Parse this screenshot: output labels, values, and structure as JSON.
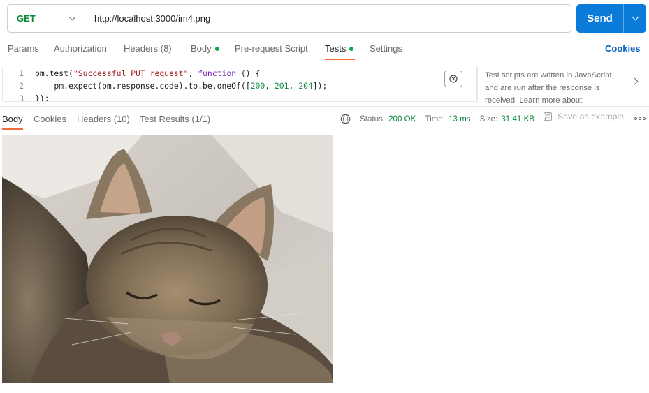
{
  "request": {
    "method": "GET",
    "url": "http://localhost:3000/im4.png",
    "send_label": "Send"
  },
  "request_tabs": {
    "params": "Params",
    "authorization": "Authorization",
    "headers": "Headers (8)",
    "body": "Body",
    "pre_request": "Pre-request Script",
    "tests": "Tests",
    "settings": "Settings",
    "cookies": "Cookies"
  },
  "editor": {
    "line_numbers": [
      "1",
      "2",
      "3"
    ],
    "line1": {
      "a": "pm.test(",
      "b": "\"Successful PUT request\"",
      "c": ", ",
      "d": "function",
      "e": " () {"
    },
    "line2": {
      "a": "    pm.expect(pm.response.code).to.be.oneOf([",
      "n1": "200",
      "s1": ", ",
      "n2": "201",
      "s2": ", ",
      "n3": "204",
      "e": "]);"
    },
    "line3": "});"
  },
  "help": {
    "text": "Test scripts are written in JavaScript, and are run after the response is received. Learn more about"
  },
  "response": {
    "tabs": {
      "body": "Body",
      "cookies": "Cookies",
      "headers": "Headers (10)",
      "test_results": "Test Results (1/1)"
    },
    "status_label": "Status:",
    "status_value": "200 OK",
    "time_label": "Time:",
    "time_value": "13 ms",
    "size_label": "Size:",
    "size_value": "31.41 KB",
    "save_as_example": "Save as example"
  },
  "icons": {
    "method_dropdown": "chevron-down-icon",
    "send_dropdown": "chevron-down-icon",
    "magic": "magic-wand-icon",
    "help_expand": "chevron-right-icon",
    "globe": "globe-icon",
    "save": "save-icon",
    "more": "more-horizontal-icon"
  },
  "colors": {
    "method": "#0b8a3a",
    "send": "#0a7bd8",
    "active_tab_underline": "#f26b3a",
    "dot": "#0ba64d",
    "status_ok": "#0b8a3a",
    "link": "#0a64c8"
  }
}
